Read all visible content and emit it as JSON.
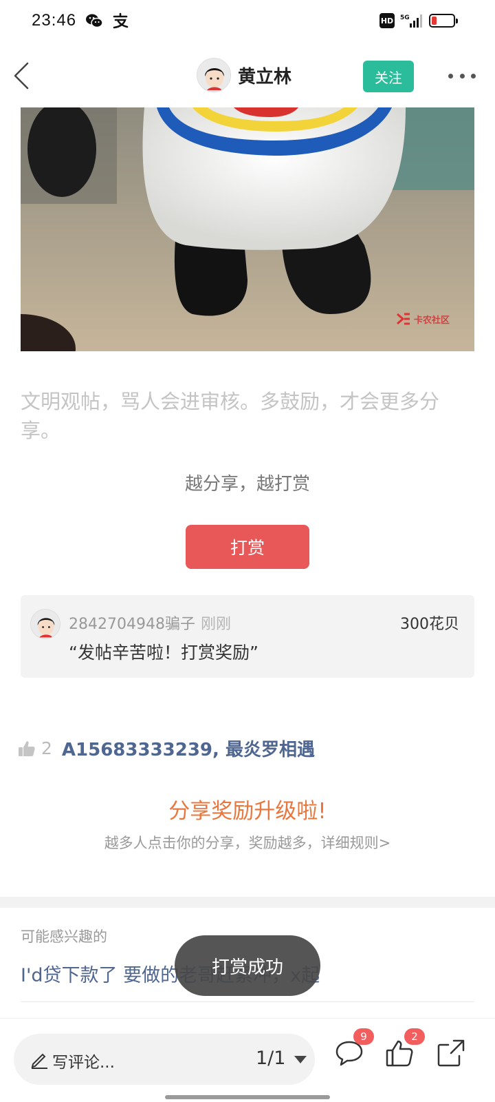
{
  "status_bar": {
    "time": "23:46",
    "left_icons": [
      "wechat-icon",
      "alipay-icon"
    ],
    "right_icons": [
      "hd-icon",
      "5g-signal-icon",
      "battery-low-icon"
    ],
    "battery_color": "#e53935"
  },
  "header": {
    "back_icon": "chevron-left-icon",
    "author_name": "黄立林",
    "follow_label": "关注",
    "follow_color": "#2bbd9b",
    "more_icon": "more-dots-icon"
  },
  "post": {
    "watermark_text": "卡农社区",
    "notice": "文明观帖，骂人会进审核。多鼓励，才会更多分享。"
  },
  "reward": {
    "slogan": "越分享，越打赏",
    "button_label": "打赏",
    "button_color": "#e85859",
    "tip": {
      "user": "2842704948骗子",
      "time": "刚刚",
      "amount": "300花贝",
      "message": "“发帖辛苦啦！打赏奖励”"
    }
  },
  "likes": {
    "count": "2",
    "names": "A15683333239, 最炎罗相遇"
  },
  "share": {
    "title": "分享奖励升级啦!",
    "title_color": "#e9773d",
    "description": "越多人点击你的分享，奖励越多，详细规则>"
  },
  "related": {
    "section_label": "可能感兴趣的",
    "item_title": "I'd贷下款了 要做的老哥赶紧冲，x起"
  },
  "toast": {
    "message": "打赏成功"
  },
  "bottom_bar": {
    "comment_placeholder": "写评论...",
    "page_indicator": "1/1",
    "comment_badge": "9",
    "like_badge": "2",
    "badge_color": "#f25d5d"
  }
}
